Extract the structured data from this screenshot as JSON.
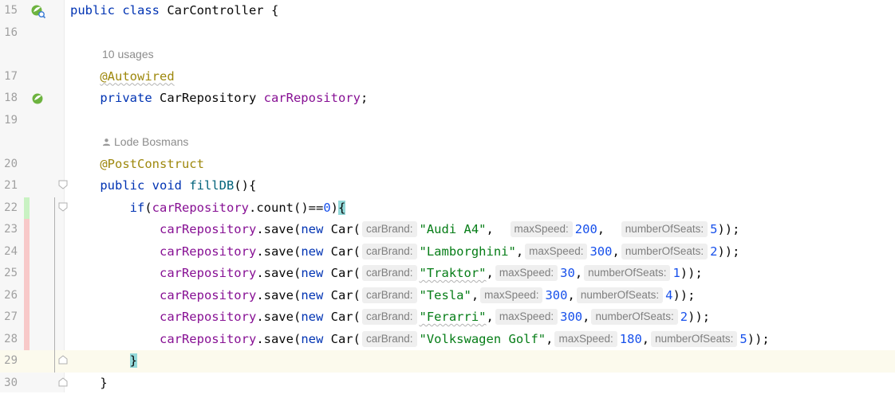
{
  "editor": {
    "lines": [
      {
        "num": "15",
        "code": [
          {
            "t": "public class ",
            "c": "kw"
          },
          {
            "t": "CarController {"
          }
        ]
      },
      {
        "num": "16"
      },
      {
        "hint": "10 usages"
      },
      {
        "num": "17",
        "code": [
          {
            "t": "    "
          },
          {
            "t": "@Autowired",
            "c": "ann squig"
          }
        ]
      },
      {
        "num": "18",
        "code": [
          {
            "t": "    "
          },
          {
            "t": "private ",
            "c": "kw"
          },
          {
            "t": "CarRepository "
          },
          {
            "t": "carRepository",
            "c": "fld"
          },
          {
            "t": ";"
          }
        ]
      },
      {
        "num": "19"
      },
      {
        "hint": "Lode Bosmans"
      },
      {
        "num": "20",
        "code": [
          {
            "t": "    "
          },
          {
            "t": "@PostConstruct",
            "c": "ann"
          }
        ]
      },
      {
        "num": "21",
        "code": [
          {
            "t": "    "
          },
          {
            "t": "public void ",
            "c": "kw"
          },
          {
            "t": "fillDB",
            "c": "mth"
          },
          {
            "t": "(){"
          }
        ]
      },
      {
        "num": "22",
        "code": [
          {
            "t": "        "
          },
          {
            "t": "if",
            "c": "kw"
          },
          {
            "t": "("
          },
          {
            "t": "carRepository",
            "c": "fld"
          },
          {
            "t": ".count()=="
          },
          {
            "t": "0",
            "c": "num"
          },
          {
            "t": ")"
          },
          {
            "t": "{",
            "c": "brace-hl"
          }
        ]
      },
      {
        "num": "23",
        "car": {
          "brand": "\"Audi A4\"",
          "sep1": ",  ",
          "speed": "200",
          "sep2": ",  ",
          "seats": "5"
        }
      },
      {
        "num": "24",
        "car": {
          "brand": "\"Lamborghini\"",
          "sep1": ",",
          "speed": "300",
          "sep2": ",",
          "seats": "2"
        }
      },
      {
        "num": "25",
        "car": {
          "brand": "\"Traktor\"",
          "sep1": ",",
          "speed": "30",
          "sep2": ",",
          "seats": "1",
          "squig": true
        }
      },
      {
        "num": "26",
        "car": {
          "brand": "\"Tesla\"",
          "sep1": ",",
          "speed": "300",
          "sep2": ",",
          "seats": "4"
        }
      },
      {
        "num": "27",
        "car": {
          "brand": "\"Ferarri\"",
          "sep1": ",",
          "speed": "300",
          "sep2": ",",
          "seats": "2",
          "squig": true
        }
      },
      {
        "num": "28",
        "car": {
          "brand": "\"Volkswagen Golf\"",
          "sep1": ",",
          "speed": "180",
          "sep2": ",",
          "seats": "5"
        }
      },
      {
        "num": "29",
        "code": [
          {
            "t": "        "
          },
          {
            "t": "}",
            "c": "brace-hl"
          }
        ]
      },
      {
        "num": "30",
        "code": [
          {
            "t": "    }"
          }
        ]
      }
    ],
    "car_call": {
      "receiver": "carRepository",
      "method": ".save(",
      "new_kw": "new ",
      "ctor": "Car(",
      "close": "));",
      "hint_brand": "carBrand:",
      "hint_speed": "maxSpeed:",
      "hint_seats": "numberOfSeats:"
    }
  },
  "colors": {
    "keyword": "#0033b3",
    "annotation": "#9e880d",
    "field": "#871094",
    "method": "#00627a",
    "string": "#067d17",
    "number": "#1750eb",
    "brace_highlight": "#93d9d9",
    "vcs_added": "#c9f2c3",
    "vcs_modified": "#f8c9c9"
  }
}
